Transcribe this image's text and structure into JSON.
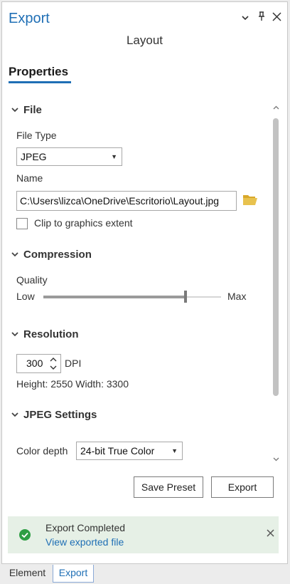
{
  "window": {
    "title": "Export",
    "subtitle": "Layout"
  },
  "tabs": {
    "properties": "Properties"
  },
  "file": {
    "section_label": "File",
    "file_type_label": "File Type",
    "file_type_value": "JPEG",
    "name_label": "Name",
    "name_value": "C:\\Users\\lizca\\OneDrive\\Escritorio\\Layout.jpg",
    "clip_label": "Clip to graphics extent",
    "clip_checked": false
  },
  "compression": {
    "section_label": "Compression",
    "quality_label": "Quality",
    "low_label": "Low",
    "max_label": "Max",
    "quality_fraction": 0.8
  },
  "resolution": {
    "section_label": "Resolution",
    "dpi_value": "300",
    "dpi_unit": "DPI",
    "dimensions_text": "Height: 2550 Width: 3300"
  },
  "jpeg_settings": {
    "section_label": "JPEG Settings",
    "color_depth_label": "Color depth",
    "color_depth_value": "24-bit True Color"
  },
  "actions": {
    "save_preset": "Save Preset",
    "export": "Export"
  },
  "notification": {
    "title": "Export Completed",
    "link": "View exported file"
  },
  "bottom_tabs": {
    "element": "Element",
    "export": "Export"
  },
  "colors": {
    "accent": "#1f6fb5",
    "success": "#2e9e44",
    "notify_bg": "#e6f0e6",
    "folder": "#e0b93a"
  }
}
